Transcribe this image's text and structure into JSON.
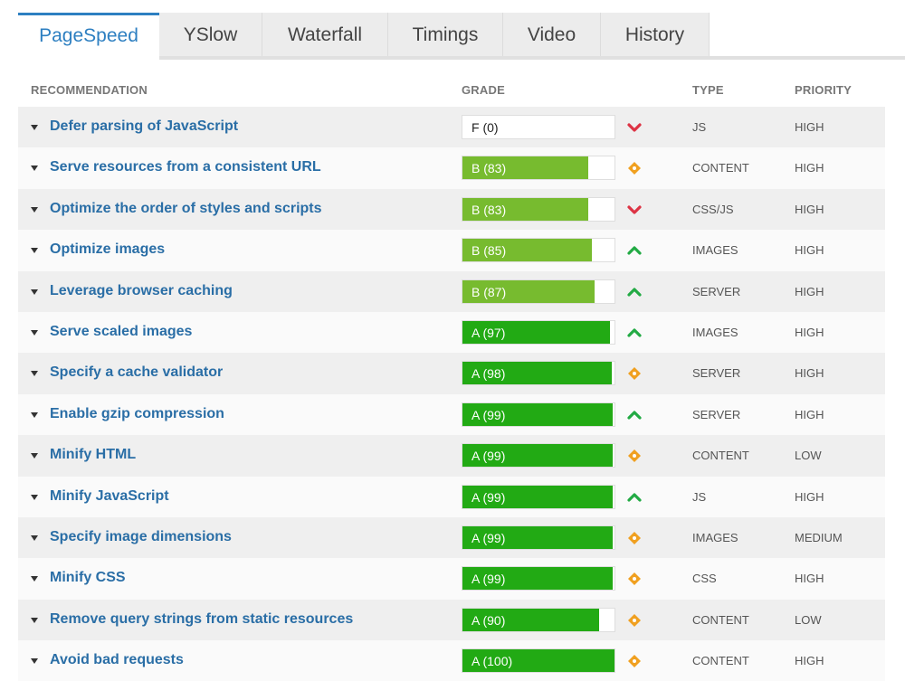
{
  "tabs": [
    {
      "label": "PageSpeed",
      "active": true
    },
    {
      "label": "YSlow",
      "active": false
    },
    {
      "label": "Waterfall",
      "active": false
    },
    {
      "label": "Timings",
      "active": false
    },
    {
      "label": "Video",
      "active": false
    },
    {
      "label": "History",
      "active": false
    }
  ],
  "columns": {
    "recommendation": "RECOMMENDATION",
    "grade": "GRADE",
    "type": "TYPE",
    "priority": "PRIORITY"
  },
  "colors": {
    "link": "#2a6ea6",
    "grade_b": "#77bb2f",
    "grade_a": "#22aa14",
    "trend_down": "#dd3344",
    "trend_up": "#22aa44",
    "neutral": "#f0a020"
  },
  "rows": [
    {
      "recommendation": "Defer parsing of JavaScript",
      "grade": "F (0)",
      "score": 0,
      "trend": "down",
      "type": "JS",
      "priority": "HIGH"
    },
    {
      "recommendation": "Serve resources from a consistent URL",
      "grade": "B (83)",
      "score": 83,
      "trend": "neutral",
      "type": "CONTENT",
      "priority": "HIGH"
    },
    {
      "recommendation": "Optimize the order of styles and scripts",
      "grade": "B (83)",
      "score": 83,
      "trend": "down",
      "type": "CSS/JS",
      "priority": "HIGH"
    },
    {
      "recommendation": "Optimize images",
      "grade": "B (85)",
      "score": 85,
      "trend": "up",
      "type": "IMAGES",
      "priority": "HIGH"
    },
    {
      "recommendation": "Leverage browser caching",
      "grade": "B (87)",
      "score": 87,
      "trend": "up",
      "type": "SERVER",
      "priority": "HIGH"
    },
    {
      "recommendation": "Serve scaled images",
      "grade": "A (97)",
      "score": 97,
      "trend": "up",
      "type": "IMAGES",
      "priority": "HIGH"
    },
    {
      "recommendation": "Specify a cache validator",
      "grade": "A (98)",
      "score": 98,
      "trend": "neutral",
      "type": "SERVER",
      "priority": "HIGH"
    },
    {
      "recommendation": "Enable gzip compression",
      "grade": "A (99)",
      "score": 99,
      "trend": "up",
      "type": "SERVER",
      "priority": "HIGH"
    },
    {
      "recommendation": "Minify HTML",
      "grade": "A (99)",
      "score": 99,
      "trend": "neutral",
      "type": "CONTENT",
      "priority": "LOW"
    },
    {
      "recommendation": "Minify JavaScript",
      "grade": "A (99)",
      "score": 99,
      "trend": "up",
      "type": "JS",
      "priority": "HIGH"
    },
    {
      "recommendation": "Specify image dimensions",
      "grade": "A (99)",
      "score": 99,
      "trend": "neutral",
      "type": "IMAGES",
      "priority": "MEDIUM"
    },
    {
      "recommendation": "Minify CSS",
      "grade": "A (99)",
      "score": 99,
      "trend": "neutral",
      "type": "CSS",
      "priority": "HIGH"
    },
    {
      "recommendation": "Remove query strings from static resources",
      "grade": "A (90)",
      "score": 90,
      "trend": "neutral",
      "type": "CONTENT",
      "priority": "LOW"
    },
    {
      "recommendation": "Avoid bad requests",
      "grade": "A (100)",
      "score": 100,
      "trend": "neutral",
      "type": "CONTENT",
      "priority": "HIGH"
    }
  ]
}
